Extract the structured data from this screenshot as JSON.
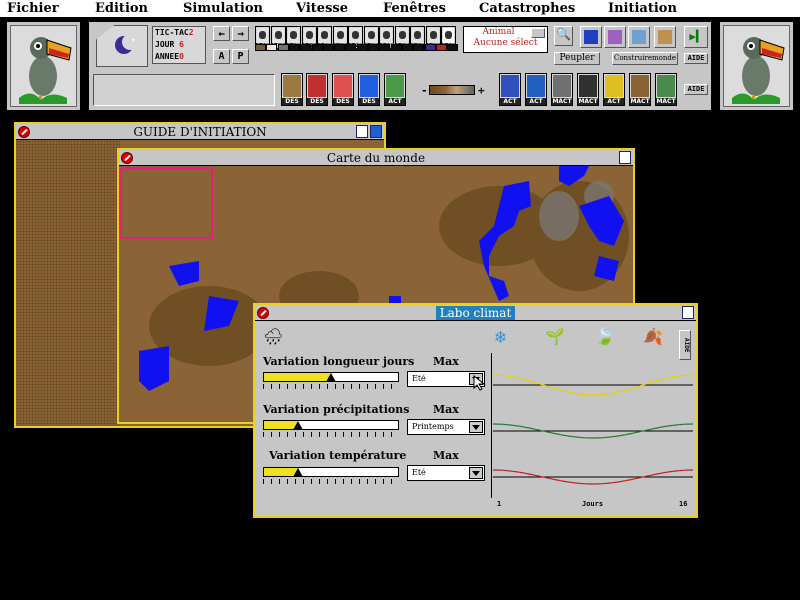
{
  "menu": [
    "Fichier",
    "Edition",
    "Simulation",
    "Vitesse",
    "Fenêtres",
    "Catastrophes",
    "Initiation"
  ],
  "clock": {
    "tictac_label": "TIC-TAC",
    "tictac_value": "2",
    "jour_label": "JOUR",
    "jour_value": "6",
    "annee_label": "ANNEE",
    "annee_value": "0"
  },
  "toolbar": {
    "button_a": "A",
    "button_p": "P",
    "act_label": "ACT",
    "des_label": "DES",
    "animal_label": "Animal",
    "animal_value": "Aucune sélect",
    "peupler": "Peupler",
    "construire": "Construiremonde",
    "aide": "AIDE",
    "minus": "-",
    "plus": "+",
    "mact_label": "MACT"
  },
  "palette_colors": [
    "#7a5a2a",
    "#f0e8c8",
    "#707070",
    "#101010",
    "#101010",
    "#101010",
    "#101010",
    "#101010",
    "#101010",
    "#101010",
    "#101010",
    "#101010",
    "#101010",
    "#101010",
    "#101010",
    "#5020a0",
    "#c02020",
    "#101010"
  ],
  "guide_window": {
    "title": "GUIDE D'INITIATION"
  },
  "map_window": {
    "title": "Carte du monde"
  },
  "labo": {
    "title": "Labo climat",
    "max_label": "Max",
    "aide": "AIDE",
    "rows": [
      {
        "label": "Variation longueur jours",
        "select": "Eté",
        "fill": 0.5,
        "color": "#e8d000"
      },
      {
        "label": "Variation précipitations",
        "select": "Printemps",
        "fill": 0.25,
        "color": "#2a7a2a"
      },
      {
        "label": "Variation température",
        "select": "Eté",
        "fill": 0.25,
        "color": "#c02020"
      }
    ],
    "graph": {
      "x_start": "1",
      "x_mid": "Jours",
      "x_end": "16"
    }
  },
  "colors": {
    "desktop": "#000000",
    "panel": "#c6c6c6",
    "window_border": "#e8d020",
    "labo_title": "#2080c0",
    "land": "#8a6436",
    "water": "#1010f0",
    "viewport": "#e0207a"
  }
}
